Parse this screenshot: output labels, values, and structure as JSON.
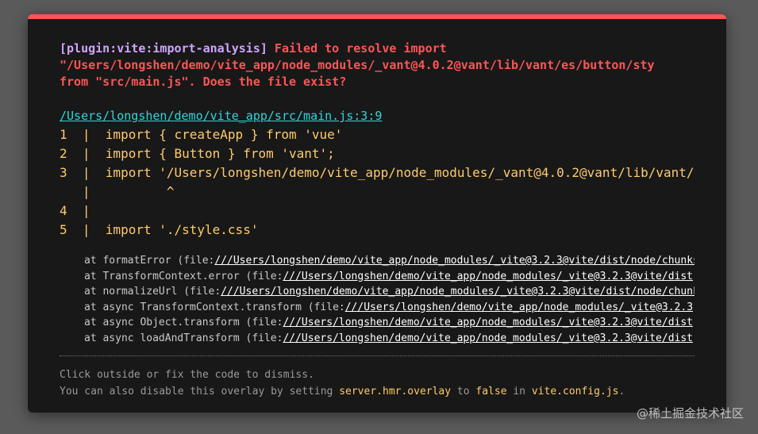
{
  "error": {
    "plugin": "[plugin:vite:import-analysis]",
    "message_line1": " Failed to resolve import",
    "message_line2": "\"/Users/longshen/demo/vite_app/node_modules/_vant@4.0.2@vant/lib/vant/es/button/sty",
    "message_line3": "from \"src/main.js\". Does the file exist?"
  },
  "file": "/Users/longshen/demo/vite_app/src/main.js:3:9",
  "frame": [
    "1  |  import { createApp } from 'vue'",
    "2  |  import { Button } from 'vant';",
    "3  |  import '/Users/longshen/demo/vite_app/node_modules/_vant@4.0.2@vant/lib/vant/",
    "   |          ^",
    "4  |",
    "5  |  import './style.css'"
  ],
  "stack": [
    {
      "prefix": "at formatError (file:",
      "link": "///Users/longshen/demo/vite_app/node_modules/_vite@3.2.3@vite/dist/node/chunks"
    },
    {
      "prefix": "at TransformContext.error (file:",
      "link": "///Users/longshen/demo/vite_app/node_modules/_vite@3.2.3@vite/dist"
    },
    {
      "prefix": "at normalizeUrl (file:",
      "link": "///Users/longshen/demo/vite_app/node_modules/_vite@3.2.3@vite/dist/node/chunk"
    },
    {
      "prefix": "at async TransformContext.transform (file:",
      "link": "///Users/longshen/demo/vite_app/node_modules/_vite@3.2.3"
    },
    {
      "prefix": "at async Object.transform (file:",
      "link": "///Users/longshen/demo/vite_app/node_modules/_vite@3.2.3@vite/dist"
    },
    {
      "prefix": "at async loadAndTransform (file:",
      "link": "///Users/longshen/demo/vite_app/node_modules/_vite@3.2.3@vite/dist"
    }
  ],
  "tip": {
    "line1": "Click outside or fix the code to dismiss.",
    "line2_pre": "You can also disable this overlay by setting ",
    "line2_code1": "server.hmr.overlay",
    "line2_mid": " to ",
    "line2_code2": "false",
    "line2_mid2": " in ",
    "line2_code3": "vite.config.js",
    "line2_end": "."
  },
  "watermark": "@稀土掘金技术社区",
  "colors": {
    "accent": "#ff5555",
    "plugin": "#cfa4ff",
    "link": "#2dd9da",
    "code": "#ffcb6b"
  }
}
